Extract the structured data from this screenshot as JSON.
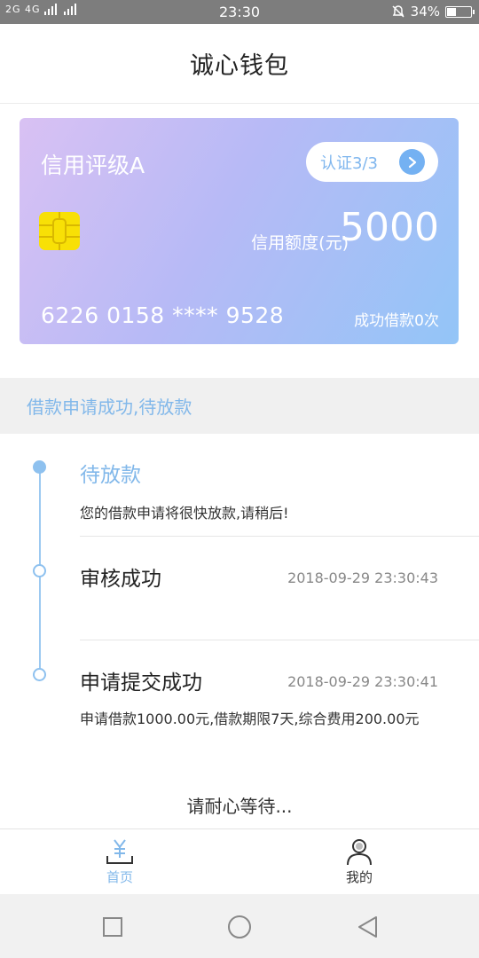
{
  "status_bar": {
    "signal_text": "2G 4G",
    "time": "23:30",
    "battery_text": "34%",
    "battery_level": 0.34
  },
  "header": {
    "title": "诚心钱包"
  },
  "card": {
    "rating": "信用评级A",
    "cert_label": "认证3/3",
    "limit_label": "信用额度(元)",
    "limit_value": "5000",
    "card_number": "6226 0158 **** 9528",
    "success_count": "成功借款0次",
    "gradient_colors": [
      "#d9c1f3",
      "#b7baf6",
      "#93c5f7"
    ],
    "chip_color": "#f8e006"
  },
  "notice": {
    "text": "借款申请成功,待放款"
  },
  "timeline": {
    "steps": [
      {
        "title": "待放款",
        "time": "",
        "desc": "您的借款申请将很快放款,请稍后!",
        "active": true
      },
      {
        "title": "审核成功",
        "time": "2018-09-29 23:30:43",
        "desc": "",
        "active": false
      },
      {
        "title": "申请提交成功",
        "time": "2018-09-29 23:30:41",
        "desc": "申请借款1000.00元,借款期限7天,综合费用200.00元",
        "active": false
      }
    ]
  },
  "wait_text": "请耐心等待...",
  "tab_bar": {
    "items": [
      {
        "label": "首页",
        "icon": "yen-wallet-icon",
        "selected": true
      },
      {
        "label": "我的",
        "icon": "user-icon",
        "selected": false
      }
    ]
  },
  "nav_bar": {
    "buttons": [
      "recent-apps-icon",
      "home-circle-icon",
      "back-triangle-icon"
    ]
  },
  "colors": {
    "accent": "#82b8ea",
    "status_bar_bg": "#7d7d7d",
    "notice_bg": "#f0f0f0"
  }
}
